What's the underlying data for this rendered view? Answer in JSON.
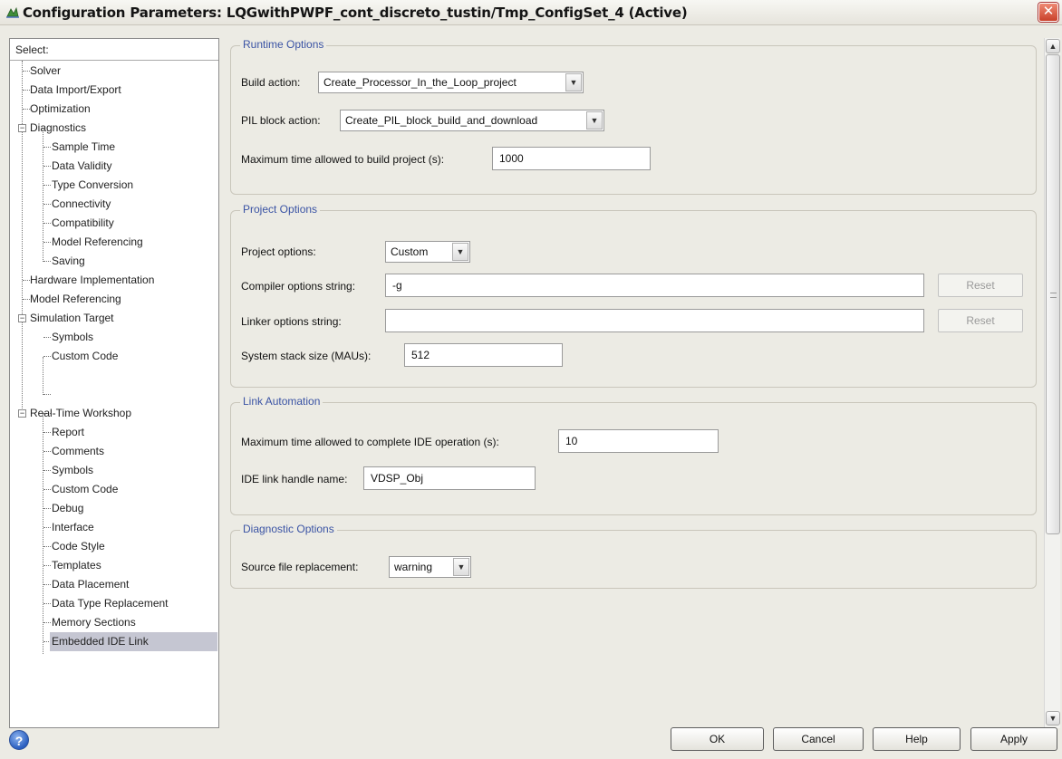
{
  "window": {
    "title": "Configuration Parameters: LQGwithPWPF_cont_discreto_tustin/Tmp_ConfigSet_4 (Active)",
    "close_glyph": "✕"
  },
  "tree": {
    "header": "Select:",
    "items": [
      {
        "label": "Solver"
      },
      {
        "label": "Data Import/Export"
      },
      {
        "label": "Optimization"
      },
      {
        "label": "Diagnostics"
      },
      {
        "label": "Sample Time"
      },
      {
        "label": "Data Validity"
      },
      {
        "label": "Type Conversion"
      },
      {
        "label": "Connectivity"
      },
      {
        "label": "Compatibility"
      },
      {
        "label": "Model Referencing"
      },
      {
        "label": "Saving"
      },
      {
        "label": "Hardware Implementation"
      },
      {
        "label": "Model Referencing"
      },
      {
        "label": "Simulation Target"
      },
      {
        "label": "Symbols"
      },
      {
        "label": "Custom Code"
      },
      {
        "label": "Real-Time Workshop"
      },
      {
        "label": "Report"
      },
      {
        "label": "Comments"
      },
      {
        "label": "Symbols"
      },
      {
        "label": "Custom Code"
      },
      {
        "label": "Debug"
      },
      {
        "label": "Interface"
      },
      {
        "label": "Code Style"
      },
      {
        "label": "Templates"
      },
      {
        "label": "Data Placement"
      },
      {
        "label": "Data Type Replacement"
      },
      {
        "label": "Memory Sections"
      },
      {
        "label": "Embedded IDE Link"
      }
    ],
    "expander_glyph": "−"
  },
  "runtime": {
    "title": "Runtime Options",
    "build_action_label": "Build action:",
    "build_action_value": "Create_Processor_In_the_Loop_project",
    "pil_label": "PIL block action:",
    "pil_value": "Create_PIL_block_build_and_download",
    "max_build_label": "Maximum time allowed to build project (s):",
    "max_build_value": "1000"
  },
  "project": {
    "title": "Project Options",
    "options_label": "Project options:",
    "options_value": "Custom",
    "compiler_label": "Compiler options string:",
    "compiler_value": "-g",
    "linker_label": "Linker options string:",
    "linker_value": "",
    "reset_label": "Reset",
    "stack_label": "System stack size (MAUs):",
    "stack_value": "512"
  },
  "link": {
    "title": "Link Automation",
    "ide_time_label": "Maximum time allowed to complete IDE operation (s):",
    "ide_time_value": "10",
    "handle_label": "IDE link handle name:",
    "handle_value": "VDSP_Obj"
  },
  "diag": {
    "title": "Diagnostic Options",
    "source_label": "Source file replacement:",
    "source_value": "warning"
  },
  "dropdown_glyph": "▼",
  "scroll": {
    "up_glyph": "▲",
    "down_glyph": "▼"
  },
  "footer": {
    "help_glyph": "?",
    "ok": "OK",
    "cancel": "Cancel",
    "help": "Help",
    "apply": "Apply"
  }
}
